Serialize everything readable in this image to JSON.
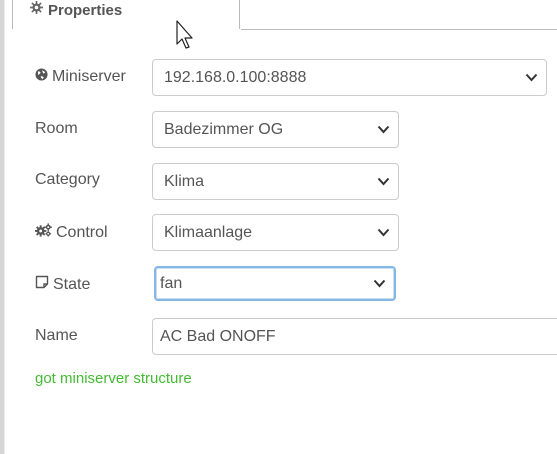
{
  "tab": {
    "label": "Properties",
    "icon": "gear-icon"
  },
  "fields": {
    "miniserver": {
      "label": "Miniserver",
      "icon": "globe-icon",
      "value": "192.168.0.100:8888"
    },
    "room": {
      "label": "Room",
      "value": "Badezimmer OG"
    },
    "category": {
      "label": "Category",
      "value": "Klima"
    },
    "control": {
      "label": "Control",
      "icon": "gears-icon",
      "value": "Klimaanlage"
    },
    "state": {
      "label": "State",
      "icon": "sticky-note-icon",
      "value": "fan"
    },
    "name": {
      "label": "Name",
      "value": "AC Bad ONOFF"
    }
  },
  "status": {
    "text": "got miniserver structure",
    "color": "#44bb33"
  },
  "colors": {
    "focus_border": "#85b7e6",
    "label": "#555555"
  }
}
